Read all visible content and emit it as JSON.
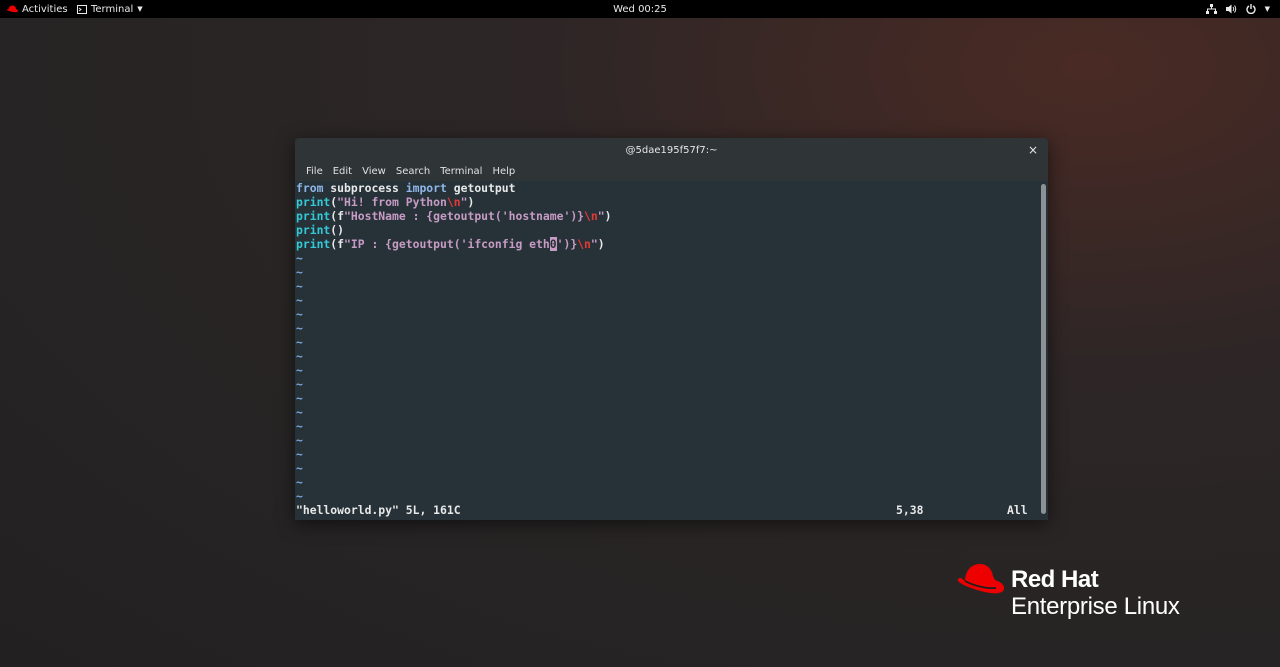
{
  "topbar": {
    "activities_label": "Activities",
    "app_label": "Terminal",
    "clock": "Wed 00:25",
    "status_icons": [
      "network-icon",
      "volume-icon",
      "power-icon"
    ]
  },
  "window": {
    "title": "@5dae195f57f7:~",
    "close_glyph": "×",
    "menu": [
      "File",
      "Edit",
      "View",
      "Search",
      "Terminal",
      "Help"
    ]
  },
  "editor": {
    "line1": {
      "kw1": "from",
      "mod": " subprocess ",
      "kw2": "import",
      "name": " getoutput"
    },
    "line2": {
      "fn": "print",
      "p1": "(",
      "s1": "\"Hi! from Python",
      "esc": "\\n",
      "s2": "\"",
      "p2": ")"
    },
    "line3": {
      "fn": "print",
      "p1": "(f",
      "s1": "\"HostName : {getoutput('hostname')}",
      "esc": "\\n",
      "s2": "\"",
      "p2": ")"
    },
    "line4": {
      "fn": "print",
      "p1": "()"
    },
    "line5": {
      "fn": "print",
      "p1": "(f",
      "s1": "\"IP : {getoutput('ifconfig eth",
      "cur": "0",
      "s2": "')}",
      "esc": "\\n",
      "s3": "\"",
      "p2": ")"
    },
    "tilde": "~",
    "status_file": "\"helloworld.py\" 5L, 161C",
    "status_pos": "5,38",
    "status_scroll": "All"
  },
  "branding": {
    "name": "Red Hat",
    "product": "Enterprise Linux",
    "color": "#ee0000"
  }
}
